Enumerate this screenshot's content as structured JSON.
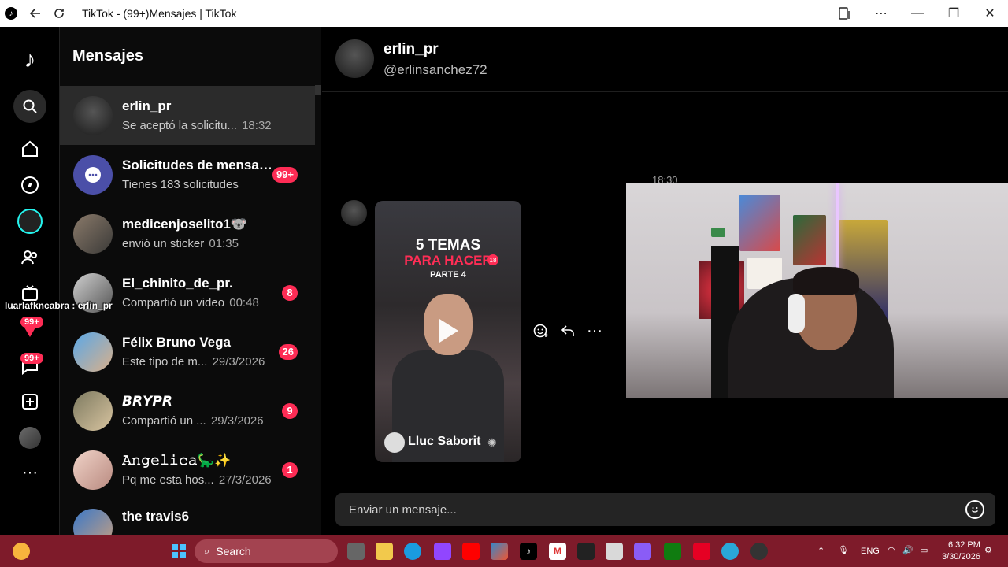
{
  "window": {
    "title": "TikTok - (99+)Mensajes | TikTok"
  },
  "rail": {
    "notifications_badge": "99+",
    "messages_badge": "99+"
  },
  "messages_panel": {
    "title": "Mensajes",
    "conversations": [
      {
        "name": "erlin_pr",
        "preview": "Se aceptó la solicitu...",
        "time": "18:32",
        "count": "",
        "active": true
      },
      {
        "name": "Solicitudes de mensaj...",
        "preview": "Tienes 183 solicitudes",
        "time": "",
        "count": "99+"
      },
      {
        "name": "medicenjoselito1🐨",
        "preview": "envió un sticker",
        "time": "01:35",
        "count": ""
      },
      {
        "name": "El_chinito_de_pr.",
        "preview": "Compartió un video",
        "time": "00:48",
        "count": "8"
      },
      {
        "name": "Félix Bruno Vega",
        "preview": "Este tipo de m...",
        "time": "29/3/2026",
        "count": "26"
      },
      {
        "name": "𝘽𝙍𝙔𝙋𝙍",
        "preview": "Compartió un ...",
        "time": "29/3/2026",
        "count": "9"
      },
      {
        "name": "𝙰𝚗𝚐𝚎𝚕𝚒𝚌𝚊🦕✨",
        "preview": "Pq me esta hos...",
        "time": "27/3/2026",
        "count": "1"
      },
      {
        "name": "the travis6",
        "preview": "",
        "time": "",
        "count": ""
      }
    ]
  },
  "chat": {
    "name": "erlin_pr",
    "handle": "@erlinsanchez72",
    "timestamp": "18:30",
    "video": {
      "line1": "5 TEMAS",
      "line2": "PARA HACER",
      "line3": "PARTE 4",
      "age": "18",
      "author": "Lluc Saborit"
    },
    "composer_placeholder": "Enviar un mensaje..."
  },
  "overlay_chat": "luarlafkncabra : erlin_pr",
  "taskbar": {
    "search_label": "Search",
    "lang": "ENG",
    "time": "6:32 PM",
    "date": "3/30/2026"
  }
}
